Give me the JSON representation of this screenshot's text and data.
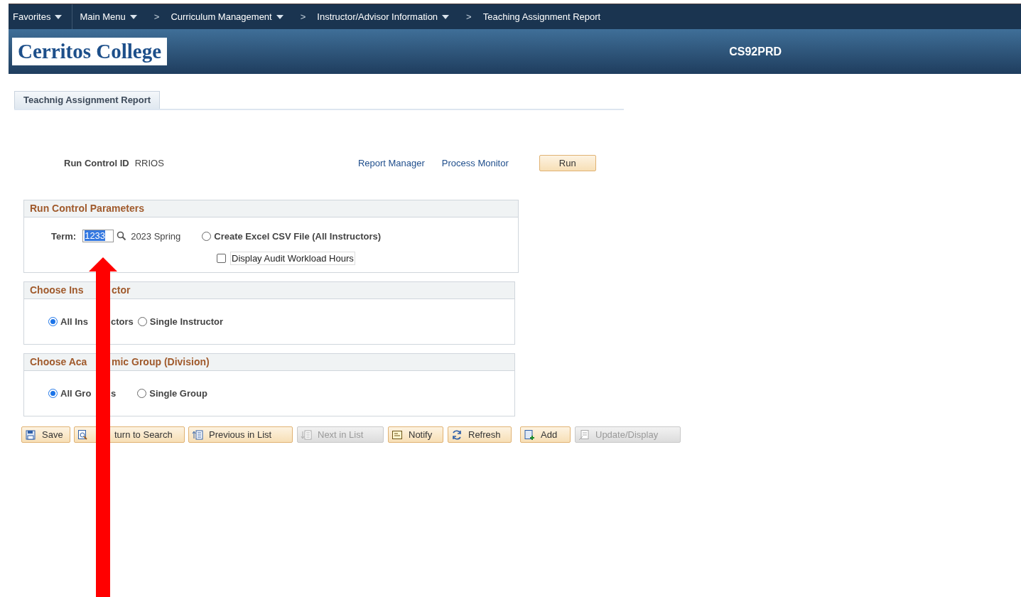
{
  "nav": [
    {
      "kind": "dropdown",
      "label": "Favorites"
    },
    {
      "kind": "dropdown",
      "label": "Main Menu"
    },
    {
      "kind": "separator",
      "label": ">"
    },
    {
      "kind": "dropdown",
      "label": "Curriculum Management"
    },
    {
      "kind": "separator",
      "label": ">"
    },
    {
      "kind": "dropdown",
      "label": "Instructor/Advisor Information"
    },
    {
      "kind": "separator",
      "label": ">"
    },
    {
      "kind": "link",
      "label": "Teaching Assignment Report"
    }
  ],
  "header": {
    "logo": "Cerritos College",
    "database": "CS92PRD"
  },
  "tabs": [
    {
      "label": "Teachnig Assignment Report",
      "selected": true
    }
  ],
  "run_control": {
    "label": "Run Control ID",
    "value": "RRIOS",
    "links": [
      "Report Manager",
      "Process Monitor"
    ],
    "run_button": "Run"
  },
  "sections": [
    {
      "title": [
        "Run Control Parameters"
      ],
      "kind": "parameters",
      "term_label": "Term:",
      "term_value": "1233",
      "term_selected": true,
      "term_description": "2023 Spring",
      "csv_option": {
        "label": "Create Excel CSV File (All Instructors)",
        "selected": false
      },
      "audit_option": {
        "label": "Display Audit Workload Hours",
        "checked": false
      }
    },
    {
      "title": [
        "Choose Ins",
        "ctor"
      ],
      "kind": "radios",
      "options": [
        {
          "label": [
            "All Ins",
            "ctors"
          ],
          "selected": true
        },
        {
          "label": [
            "Single Instructor"
          ],
          "selected": false
        }
      ]
    },
    {
      "title": [
        "Choose Aca",
        "mic Group (Division)"
      ],
      "kind": "radios",
      "options": [
        {
          "label": [
            "All Gro",
            "s"
          ],
          "selected": true
        },
        {
          "label": [
            "Single Group"
          ],
          "selected": false
        }
      ]
    }
  ],
  "toolbar": [
    {
      "label": "Save",
      "disabled": false
    },
    {
      "label": "turn to Search",
      "disabled": false
    },
    {
      "label": "Previous in List",
      "disabled": false
    },
    {
      "label": "Next in List",
      "disabled": true
    },
    {
      "label": "Notify",
      "disabled": false
    },
    {
      "label": "Refresh",
      "disabled": false
    },
    {
      "label": "Add",
      "disabled": false
    },
    {
      "label": "Update/Display",
      "disabled": true
    }
  ]
}
